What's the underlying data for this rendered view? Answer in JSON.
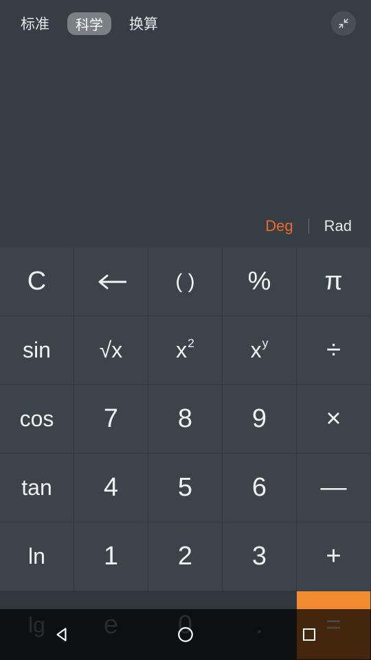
{
  "tabs": {
    "standard": "标准",
    "scientific": "科学",
    "convert": "换算",
    "active": "scientific"
  },
  "angle": {
    "deg": "Deg",
    "rad": "Rad",
    "active": "deg"
  },
  "keys": {
    "clear": "C",
    "paren": "( )",
    "percent": "%",
    "pi": "π",
    "sin": "sin",
    "sqrt": "√x",
    "square_base": "x",
    "square_sup": "2",
    "power_base": "x",
    "power_sup": "y",
    "divide": "÷",
    "cos": "cos",
    "seven": "7",
    "eight": "8",
    "nine": "9",
    "multiply": "×",
    "tan": "tan",
    "four": "4",
    "five": "5",
    "six": "6",
    "minus": "—",
    "ln": "ln",
    "one": "1",
    "two": "2",
    "three": "3",
    "plus": "+",
    "lg": "lg",
    "e": "e",
    "zero": "0",
    "dot": ".",
    "equals": "="
  },
  "colors": {
    "accent": "#f26922",
    "equals_bg": "#f28a2e",
    "bg": "#373d45",
    "key_bg": "#3d434b"
  }
}
